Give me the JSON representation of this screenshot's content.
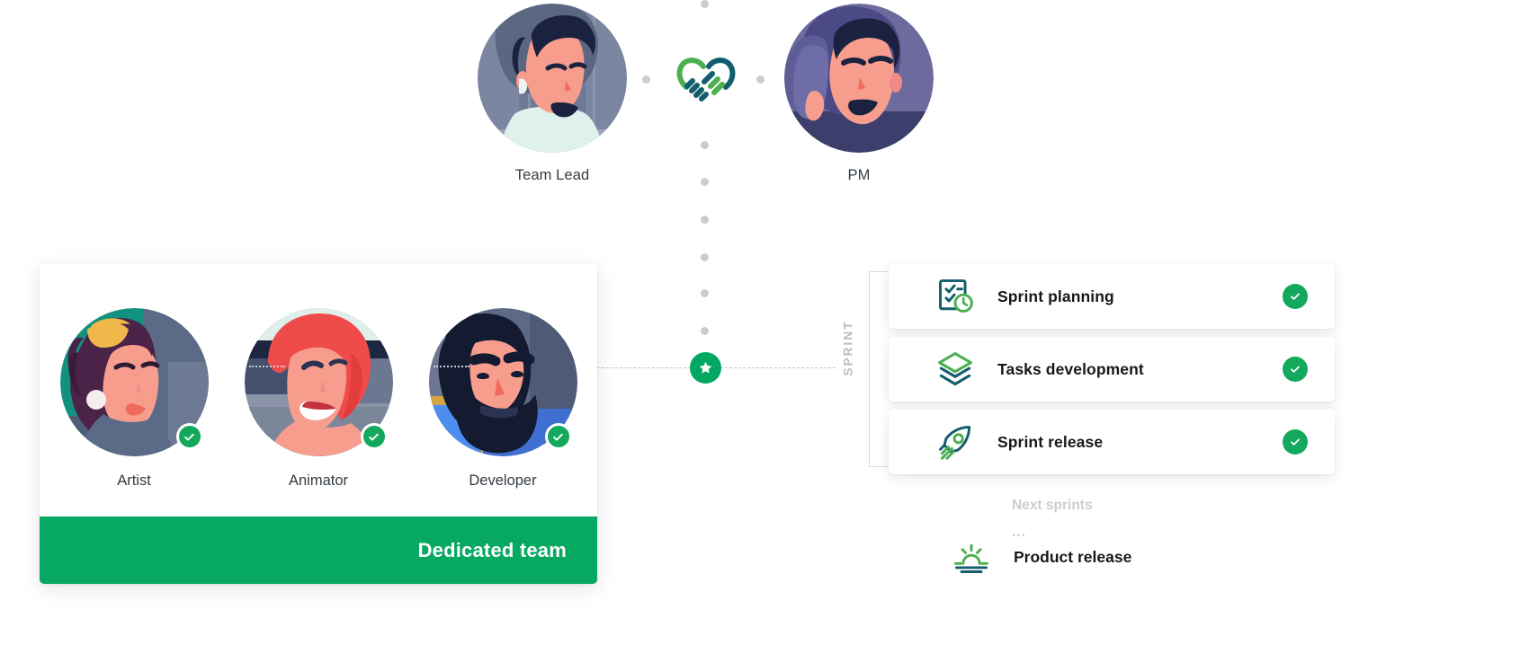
{
  "top": {
    "team_lead": {
      "label": "Team Lead",
      "avatar_icon": "avatar-team-lead"
    },
    "pm": {
      "label": "PM",
      "avatar_icon": "avatar-pm"
    },
    "connector_icon": "handshake-heart-icon"
  },
  "team_card": {
    "members": [
      {
        "label": "Artist",
        "avatar_icon": "avatar-artist",
        "status_icon": "check-badge-icon"
      },
      {
        "label": "Animator",
        "avatar_icon": "avatar-animator",
        "status_icon": "check-badge-icon"
      },
      {
        "label": "Developer",
        "avatar_icon": "avatar-developer",
        "status_icon": "check-badge-icon"
      }
    ],
    "footer_label": "Dedicated team"
  },
  "center": {
    "milestone_icon": "star-badge-icon"
  },
  "sprint": {
    "bracket_label": "SPRINT",
    "cards": [
      {
        "label": "Sprint planning",
        "icon": "clipboard-clock-icon",
        "status_icon": "check-badge-icon"
      },
      {
        "label": "Tasks development",
        "icon": "layers-stack-icon",
        "status_icon": "check-badge-icon"
      },
      {
        "label": "Sprint release",
        "icon": "rocket-icon",
        "status_icon": "check-badge-icon"
      }
    ],
    "next_sprints_label": "Next sprints",
    "ellipsis": "...",
    "product_release": {
      "label": "Product release",
      "icon": "sunrise-icon"
    }
  },
  "colors": {
    "green": "#06a862",
    "green_badge": "#13a85c",
    "teal_dark": "#125e6e",
    "green_light": "#4caf50",
    "muted": "#c9ccd1",
    "text": "#16181c"
  }
}
